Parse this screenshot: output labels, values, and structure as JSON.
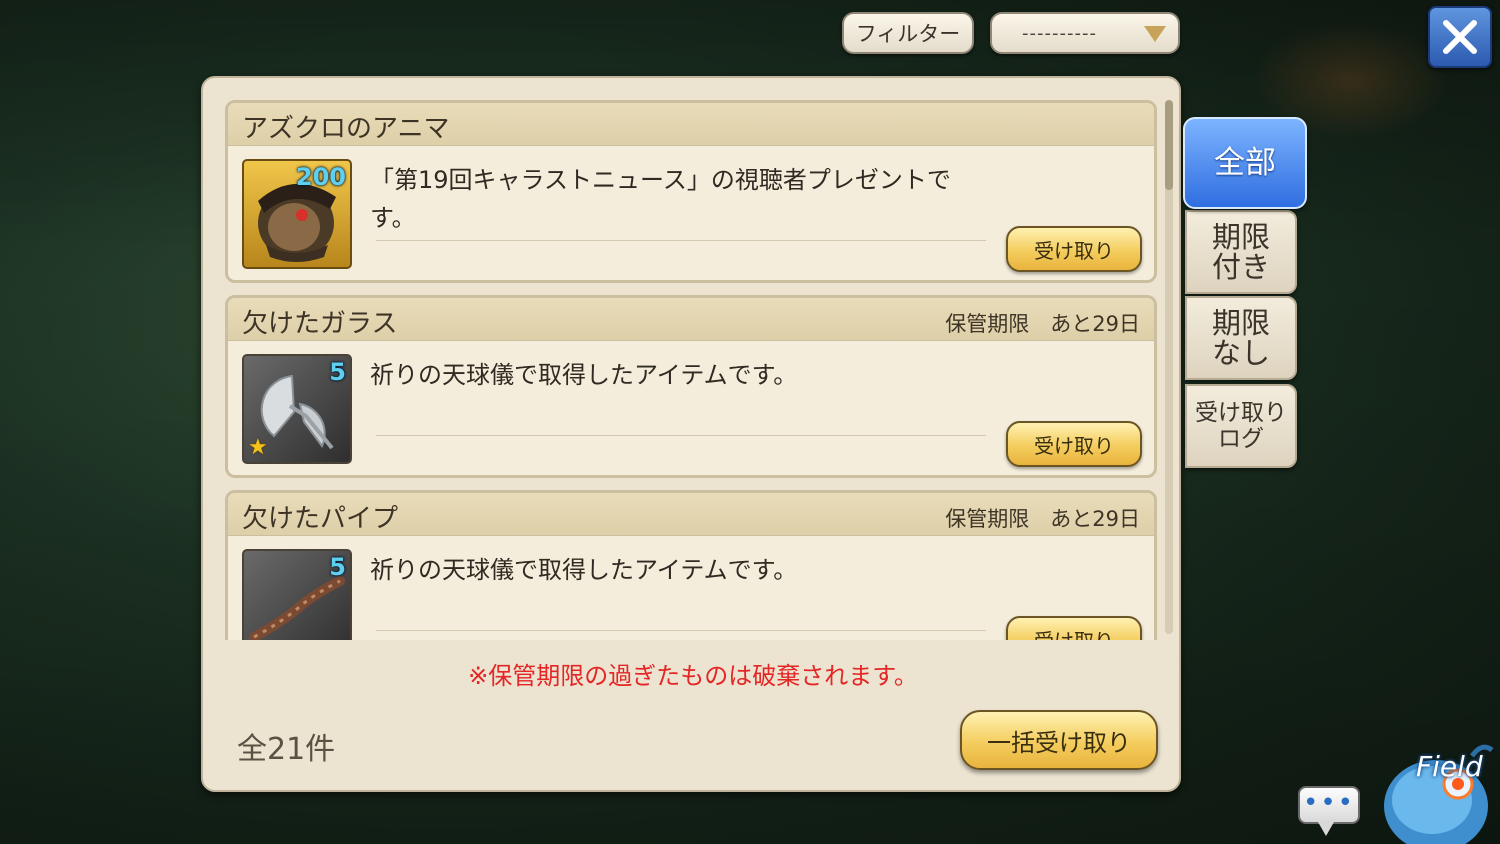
{
  "topbar": {
    "filter_label": "フィルター",
    "dropdown_value": "----------"
  },
  "items": [
    {
      "title": "アズクロのアニマ",
      "expiry": "",
      "quantity": "200",
      "rarity_star": false,
      "icon": "anima-icon",
      "description": "「第19回キャラストニュース」の視聴者プレゼントです。",
      "receive_label": "受け取り"
    },
    {
      "title": "欠けたガラス",
      "expiry": "保管期限　あと29日",
      "quantity": "5",
      "rarity_star": true,
      "icon": "broken-glass-icon",
      "description": "祈りの天球儀で取得したアイテムです。",
      "receive_label": "受け取り"
    },
    {
      "title": "欠けたパイプ",
      "expiry": "保管期限　あと29日",
      "quantity": "5",
      "rarity_star": false,
      "icon": "broken-pipe-icon",
      "description": "祈りの天球儀で取得したアイテムです。",
      "receive_label": "受け取り"
    }
  ],
  "notice": "※保管期限の過ぎたものは破棄されます。",
  "total": "全21件",
  "bulk_receive_label": "一括受け取り",
  "tabs": [
    {
      "label": "全部",
      "active": true
    },
    {
      "label": "期限\n付き",
      "active": false
    },
    {
      "label": "期限\nなし",
      "active": false
    },
    {
      "label": "受け取り\nログ",
      "active": false
    }
  ],
  "chat_dots": "•••",
  "field_label": "Field",
  "colors": {
    "notice": "#e42626",
    "active_tab": "#3a7ae8",
    "receive_button": "#f4cd5e",
    "quantity": "#5fcff0"
  }
}
